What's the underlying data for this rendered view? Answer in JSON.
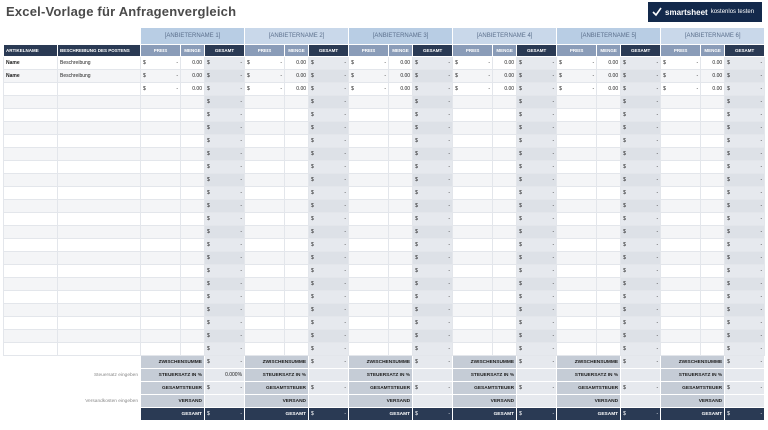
{
  "title": "Excel-Vorlage für Anfragenvergleich",
  "logo": {
    "brand": "smartsheet",
    "cta": "kostenlos testen",
    "icon": "smartsheet-check-icon",
    "color": "#13294b"
  },
  "columns": {
    "item": "ARTIKELNAME",
    "description": "BESCHREIBUNG DES POSTENS"
  },
  "vendor_columns": {
    "price": "PREIS",
    "qty": "MENGE",
    "total": "GESAMT"
  },
  "vendors": [
    {
      "name": "[ANBIETERNAME 1]"
    },
    {
      "name": "[ANBIETERNAME 2]"
    },
    {
      "name": "[ANBIETERNAME 3]"
    },
    {
      "name": "[ANBIETERNAME 4]"
    },
    {
      "name": "[ANBIETERNAME 5]"
    },
    {
      "name": "[ANBIETERNAME 6]"
    }
  ],
  "items": [
    {
      "name": "Name",
      "description": "Beschreibung",
      "price": "-",
      "qty": "0.00",
      "total": "-"
    },
    {
      "name": "Name",
      "description": "Beschreibung",
      "price": "-",
      "qty": "0.00",
      "total": "-"
    },
    {
      "name": "",
      "description": "",
      "price": "-",
      "qty": "0.00",
      "total": "-"
    }
  ],
  "empty_total": "-",
  "currency": "$",
  "empty_rows": 20,
  "summary": {
    "subtotal": "ZWISCHENSUMME",
    "tax_rate": "STEUERSATZ IN %",
    "tax_total": "GESAMTSTEUER",
    "shipping": "VERSAND",
    "total": "GESAMT",
    "tax_rate_note": "Steuersatz eingeben",
    "shipping_note": "Versandkosten eingeben",
    "first_tax_rate": "0.000%",
    "dash": "-"
  },
  "colors": {
    "header_dark": "#2a3a54",
    "header_mid": "#8a9cb8",
    "vendor_band": "#c9d8ea"
  }
}
